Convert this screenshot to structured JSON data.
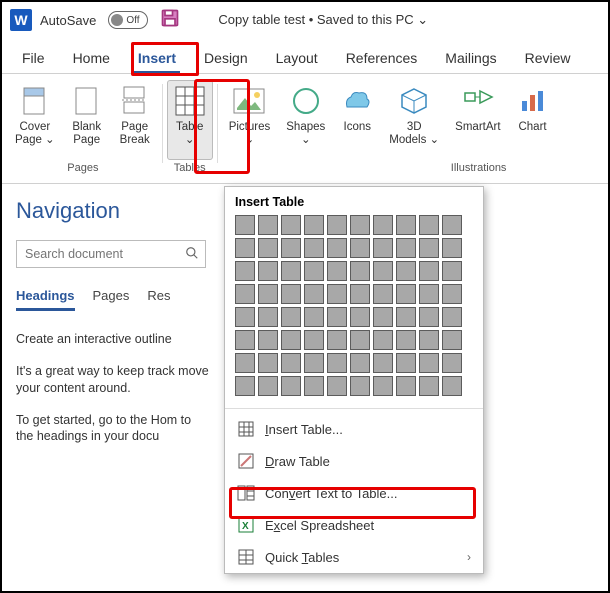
{
  "titlebar": {
    "autosave_label": "AutoSave",
    "autosave_state": "Off",
    "document_title": "Copy table test • Saved to this PC ⌄"
  },
  "tabs": [
    "File",
    "Home",
    "Insert",
    "Design",
    "Layout",
    "References",
    "Mailings",
    "Review"
  ],
  "active_tab": "Insert",
  "ribbon": {
    "pages": {
      "label": "Pages",
      "cover_page": "Cover\nPage ⌄",
      "blank_page": "Blank\nPage",
      "page_break": "Page\nBreak"
    },
    "tables": {
      "label": "Tables",
      "table": "Table\n⌄"
    },
    "illustrations": {
      "label": "Illustrations",
      "pictures": "Pictures\n⌄",
      "shapes": "Shapes\n⌄",
      "icons": "Icons",
      "models3d": "3D\nModels ⌄",
      "smartart": "SmartArt",
      "chart": "Chart"
    }
  },
  "dropdown": {
    "header": "Insert Table",
    "grid_rows": 8,
    "grid_cols": 10,
    "items": {
      "insert_table": "Insert Table...",
      "draw_table": "Draw Table",
      "convert": "Convert Text to Table...",
      "excel": "Excel Spreadsheet",
      "quick": "Quick Tables"
    }
  },
  "nav": {
    "title": "Navigation",
    "search_placeholder": "Search document",
    "tabs": {
      "headings": "Headings",
      "pages": "Pages",
      "results": "Res"
    },
    "p1": "Create an interactive outline",
    "p2": "It's a great way to keep track move your content around.",
    "p3": "To get started, go to the Hom to the headings in your docu"
  }
}
